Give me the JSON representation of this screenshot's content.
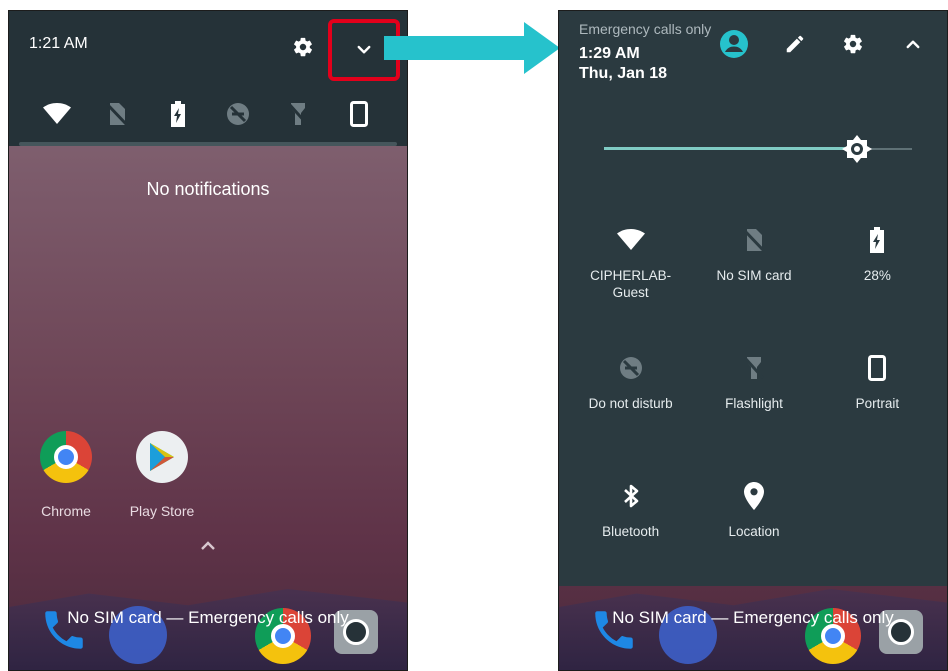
{
  "left": {
    "status_time": "1:21 AM",
    "no_notifications": "No notifications",
    "apps": [
      {
        "label": "Chrome"
      },
      {
        "label": "Play Store"
      }
    ],
    "emergency_bottom": "No SIM card — Emergency calls only"
  },
  "right": {
    "emergency_top": "Emergency calls only",
    "time": "1:29 AM",
    "date": "Thu, Jan 18",
    "brightness_level": 0.82,
    "tiles": [
      {
        "label": "CIPHERLAB-\nGuest",
        "icon": "wifi-icon"
      },
      {
        "label": "No SIM card",
        "icon": "no-sim-icon"
      },
      {
        "label": "28%",
        "icon": "battery-icon"
      },
      {
        "label": "Do not disturb",
        "icon": "dnd-icon"
      },
      {
        "label": "Flashlight",
        "icon": "flashlight-icon"
      },
      {
        "label": "Portrait",
        "icon": "portrait-icon"
      },
      {
        "label": "Bluetooth",
        "icon": "bluetooth-icon"
      },
      {
        "label": "Location",
        "icon": "location-icon"
      }
    ],
    "emergency_bottom": "No SIM card — Emergency calls only"
  },
  "colors": {
    "shade": "#253238",
    "panel": "#2b3a40",
    "accent": "#80cbc4",
    "arrow": "#26c2cc",
    "highlight": "#e3001b"
  }
}
